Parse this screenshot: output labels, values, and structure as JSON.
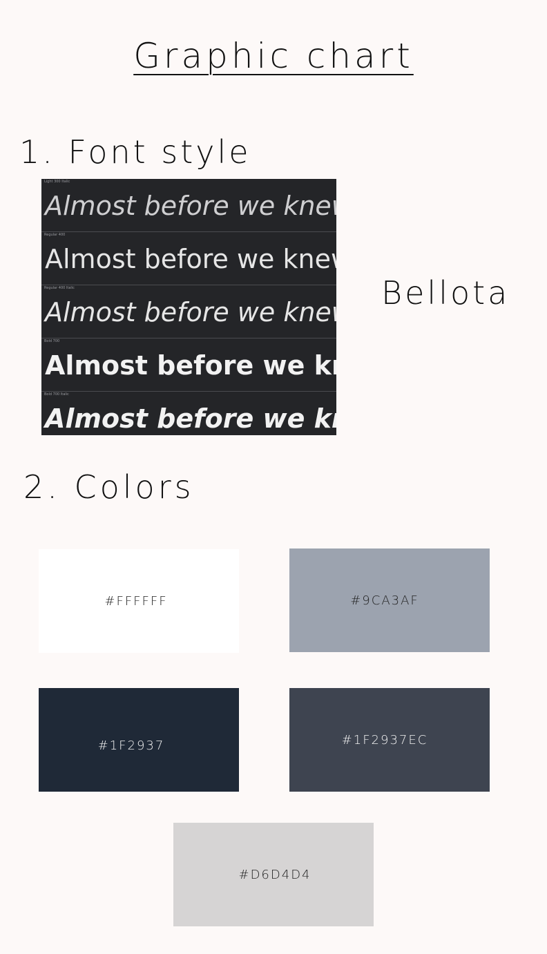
{
  "title": "Graphic chart",
  "sections": {
    "font": {
      "heading": "1. Font style",
      "font_name": "Bellota",
      "specimens": [
        {
          "label": "Light 300 Italic",
          "text": "Almost before we knew it, we had left the ground."
        },
        {
          "label": "Regular 400",
          "text": "Almost before we knew it, we had left the ground."
        },
        {
          "label": "Regular 400 Italic",
          "text": "Almost before we knew it, we had left the ground."
        },
        {
          "label": "Bold 700",
          "text": "Almost before we knew it, we had left the ground."
        },
        {
          "label": "Bold 700 Italic",
          "text": "Almost before we knew it, we had left the ground."
        }
      ]
    },
    "colors": {
      "heading": "2. Colors",
      "swatches": [
        {
          "label": "#FFFFFF",
          "color": "#FFFFFF",
          "text_color": "#222222"
        },
        {
          "label": "#9CA3AF",
          "color": "#9CA3AF",
          "text_color": "#222222"
        },
        {
          "label": "#1F2937",
          "color": "#1F2937",
          "text_color": "#F2F2F2"
        },
        {
          "label": "#1F2937EC",
          "color": "#3E4450",
          "text_color": "#F2F2F2"
        },
        {
          "label": "#D6D4D4",
          "color": "#D6D4D4",
          "text_color": "#222222"
        }
      ]
    }
  }
}
